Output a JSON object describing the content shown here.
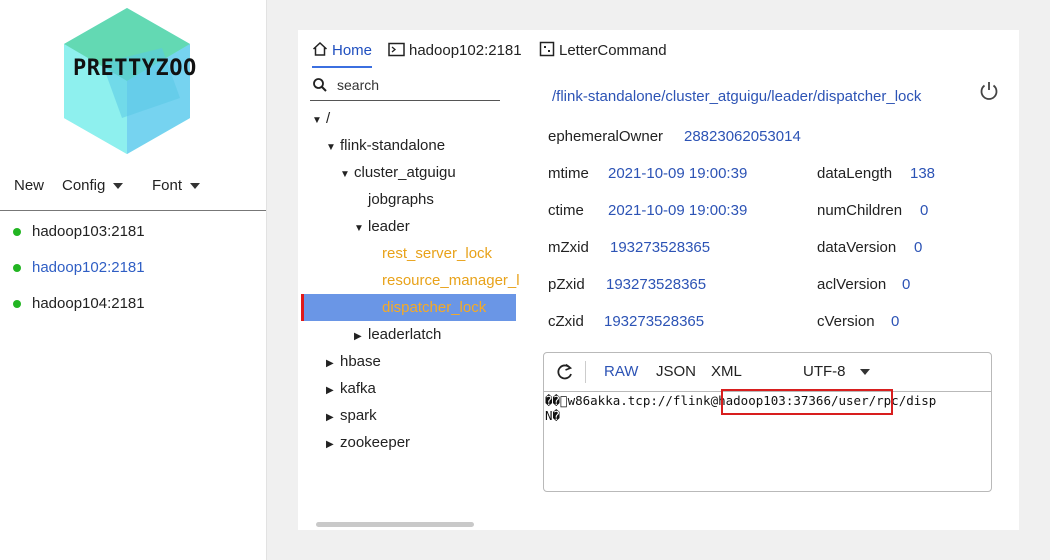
{
  "logo": {
    "text": "PRETTYZOO"
  },
  "menu": {
    "new": "New",
    "config": "Config",
    "font": "Font"
  },
  "servers": [
    {
      "name": "hadoop103:2181",
      "status_color": "#22b522",
      "active": false
    },
    {
      "name": "hadoop102:2181",
      "status_color": "#22b522",
      "active": true
    },
    {
      "name": "hadoop104:2181",
      "status_color": "#22b522",
      "active": false
    }
  ],
  "tabs": [
    {
      "label": "Home",
      "icon": "home-icon"
    },
    {
      "label": "hadoop102:2181",
      "icon": "terminal-icon"
    },
    {
      "label": "LetterCommand",
      "icon": "command-icon"
    }
  ],
  "search": {
    "placeholder": "search",
    "value": ""
  },
  "tree": [
    {
      "label": "/",
      "arrow": "down"
    },
    {
      "label": "flink-standalone",
      "arrow": "down"
    },
    {
      "label": "cluster_atguigu",
      "arrow": "down"
    },
    {
      "label": "jobgraphs",
      "arrow": ""
    },
    {
      "label": "leader",
      "arrow": "down"
    },
    {
      "label": "rest_server_lock",
      "arrow": ""
    },
    {
      "label": "resource_manager_l",
      "arrow": ""
    },
    {
      "label": "dispatcher_lock",
      "arrow": ""
    },
    {
      "label": "leaderlatch",
      "arrow": "right"
    },
    {
      "label": "hbase",
      "arrow": "right"
    },
    {
      "label": "kafka",
      "arrow": "right"
    },
    {
      "label": "spark",
      "arrow": "right"
    },
    {
      "label": "zookeeper",
      "arrow": "right"
    }
  ],
  "node": {
    "path": "/flink-standalone/cluster_atguigu/leader/dispatcher_lock",
    "ephemeralOwner": {
      "label": "ephemeralOwner",
      "value": "28823062053014"
    },
    "mtime": {
      "label": "mtime",
      "value": "2021-10-09 19:00:39"
    },
    "ctime": {
      "label": "ctime",
      "value": "2021-10-09 19:00:39"
    },
    "mZxid": {
      "label": "mZxid",
      "value": "193273528365"
    },
    "pZxid": {
      "label": "pZxid",
      "value": "193273528365"
    },
    "cZxid": {
      "label": "cZxid",
      "value": "193273528365"
    },
    "dataLength": {
      "label": "dataLength",
      "value": "138"
    },
    "numChildren": {
      "label": "numChildren",
      "value": "0"
    },
    "dataVersion": {
      "label": "dataVersion",
      "value": "0"
    },
    "aclVersion": {
      "label": "aclVersion",
      "value": "0"
    },
    "cVersion": {
      "label": "cVersion",
      "value": "0"
    }
  },
  "viewer": {
    "raw": "RAW",
    "json": "JSON",
    "xml": "XML",
    "encoding": "UTF-8",
    "content_line1": "��\u0000w86akka.tcp://flink@hadoop103:37366/user/rpc/disp",
    "content_line2": "N�"
  }
}
